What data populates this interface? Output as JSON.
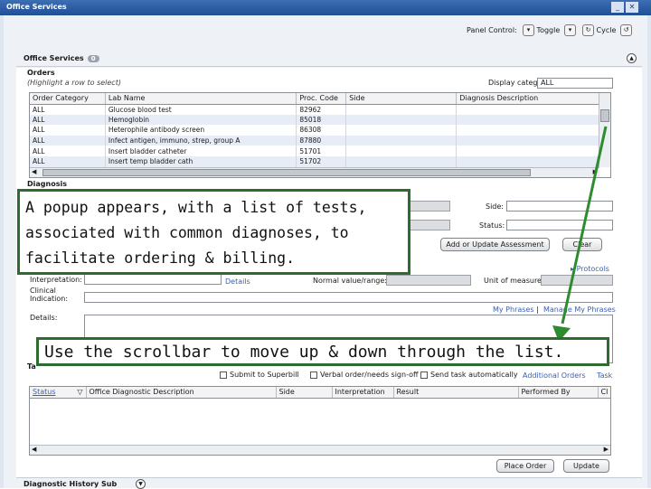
{
  "window": {
    "title": "Office Services"
  },
  "panel": {
    "label": "Panel Control:",
    "toggle": "Toggle",
    "cycle": "Cycle"
  },
  "section": {
    "title": "Office Services",
    "badge": "0"
  },
  "orders": {
    "heading": "Orders",
    "hint": "(Highlight a row to select)",
    "display_category_label": "Display category:",
    "display_category_value": "ALL",
    "columns": [
      "Order Category",
      "Lab Name",
      "Proc. Code",
      "Side",
      "Diagnosis Description"
    ],
    "rows": [
      [
        "ALL",
        "Glucose blood test",
        "82962",
        "",
        ""
      ],
      [
        "ALL",
        "Hemoglobin",
        "85018",
        "",
        ""
      ],
      [
        "ALL",
        "Heterophile antibody screen",
        "86308",
        "",
        ""
      ],
      [
        "ALL",
        "Infect antigen, immuno, strep, group A",
        "87880",
        "",
        ""
      ],
      [
        "ALL",
        "Insert bladder catheter",
        "51701",
        "",
        ""
      ],
      [
        "ALL",
        "Insert temp bladder cath",
        "51702",
        "",
        ""
      ]
    ]
  },
  "diagnosis": {
    "heading": "Diagnosis",
    "side_label": "Side:",
    "status_label": "Status:",
    "add_button": "Add or Update Assessment",
    "clear_button": "Clear",
    "protocols_link": "Protocols",
    "interpretation_label": "Interpretation:",
    "details_link": "Details",
    "normal_label": "Normal value/range:",
    "unit_label": "Unit of measure:",
    "clinical_label_1": "Clinical",
    "clinical_label_2": "Indication:",
    "details_label": "Details:",
    "my_phrases_link": "My Phrases",
    "manage_phrases_link": "Manage My Phrases",
    "separator": "|"
  },
  "task": {
    "heading": "Ta",
    "submit_label": "Submit to Superbill",
    "verbal_label": "Verbal order/needs sign-off",
    "send_label": "Send task automatically",
    "additional_orders_link": "Additional Orders",
    "task_link": "Task"
  },
  "results": {
    "columns": [
      "Status",
      "Office Diagnostic Description",
      "Side",
      "Interpretation",
      "Result",
      "Performed By",
      "Cl"
    ]
  },
  "footer": {
    "place_order": "Place Order",
    "update": "Update",
    "bottom_section": "Diagnostic History Sub"
  },
  "annotations": {
    "popup_note": "A popup appears, with a list of tests, associated with common diagnoses, to facilitate ordering & billing.",
    "scroll_note": "Use the scrollbar to move up & down through the list."
  },
  "colors": {
    "titlebar": "#2a5aa2",
    "callout_border": "#2e6b2e",
    "arrow": "#2e8b2e",
    "row_alt": "#e7edf6"
  }
}
